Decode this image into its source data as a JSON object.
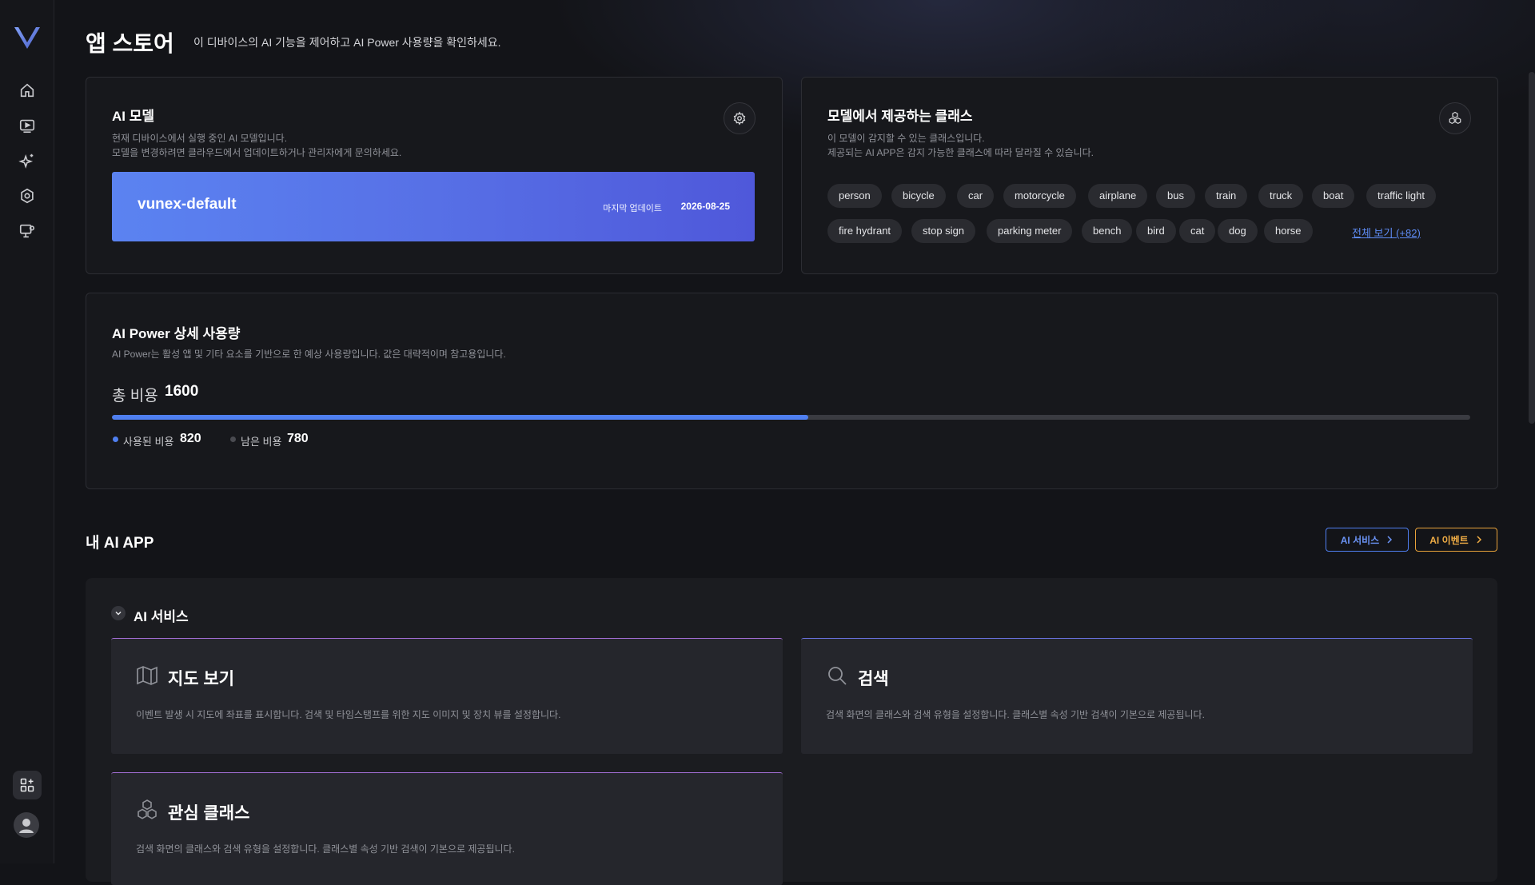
{
  "header": {
    "title": "앱 스토어",
    "description": "이 디바이스의 AI 기능을 제어하고 AI Power 사용량을 확인하세요."
  },
  "sidebar": {
    "icons": [
      "home-icon",
      "video-icon",
      "ai-sparkle-icon",
      "settings-icon",
      "monitor-settings-icon"
    ],
    "bottom": [
      "app-store-icon",
      "user-avatar-icon"
    ]
  },
  "model_card": {
    "title": "AI 모델",
    "desc_line1": "현재 디바이스에서 실행 중인 AI 모델입니다.",
    "desc_line2": "모델을 변경하려면 클라우드에서 업데이트하거나 관리자에게 문의하세요.",
    "model_name": "vunex-default",
    "last_update_label": "마지막 업데이트",
    "last_update_date": "2026-08-25"
  },
  "classes_card": {
    "title": "모델에서 제공하는 클래스",
    "desc_line1": "이 모델이 감지할 수 있는 클래스입니다.",
    "desc_line2": "제공되는 AI APP은 감지 가능한 클래스에 따라 달라질 수 있습니다.",
    "row1": [
      "person",
      "bicycle",
      "car",
      "motorcycle",
      "airplane",
      "bus",
      "train",
      "truck",
      "boat",
      "traffic light"
    ],
    "row2": [
      "fire hydrant",
      "stop sign",
      "parking meter",
      "bench",
      "bird",
      "cat",
      "dog",
      "horse"
    ],
    "view_all": "전체 보기 (+82)"
  },
  "power_card": {
    "title": "AI Power 상세 사용량",
    "desc": "AI Power는 활성 앱 및 기타 요소를 기반으로 한 예상 사용량입니다. 값은 대략적이며 참고용입니다.",
    "total_label": "총 비용",
    "total_value": "1600",
    "used_label": "사용된 비용",
    "used_value": "820",
    "remaining_label": "남은 비용",
    "remaining_value": "780",
    "used_fraction": 0.5125,
    "colors": {
      "used": "#4f7ff0",
      "remaining": "#3a3b41"
    }
  },
  "my_apps": {
    "title": "내 AI APP",
    "btn_services": "AI 서비스",
    "btn_events": "AI 이벤트",
    "colors": {
      "services": "#4f7ff0",
      "events": "#e8a23a"
    },
    "group_label": "AI 서비스",
    "apps": [
      {
        "title": "지도 보기",
        "desc": "이벤트 발생 시 지도에 좌표를 표시합니다. 검색 및 타임스탬프를 위한 지도 이미지 및 장치 뷰를 설정합니다.",
        "icon": "map-icon"
      },
      {
        "title": "검색",
        "desc": "검색 화면의 클래스와 검색 유형을 설정합니다. 클래스별 속성 기반 검색이 기본으로 제공됩니다.",
        "icon": "search-icon"
      },
      {
        "title": "관심 클래스",
        "desc": "검색 화면의 클래스와 검색 유형을 설정합니다. 클래스별 속성 기반 검색이 기본으로 제공됩니다.",
        "icon": "cubes-icon"
      }
    ]
  }
}
